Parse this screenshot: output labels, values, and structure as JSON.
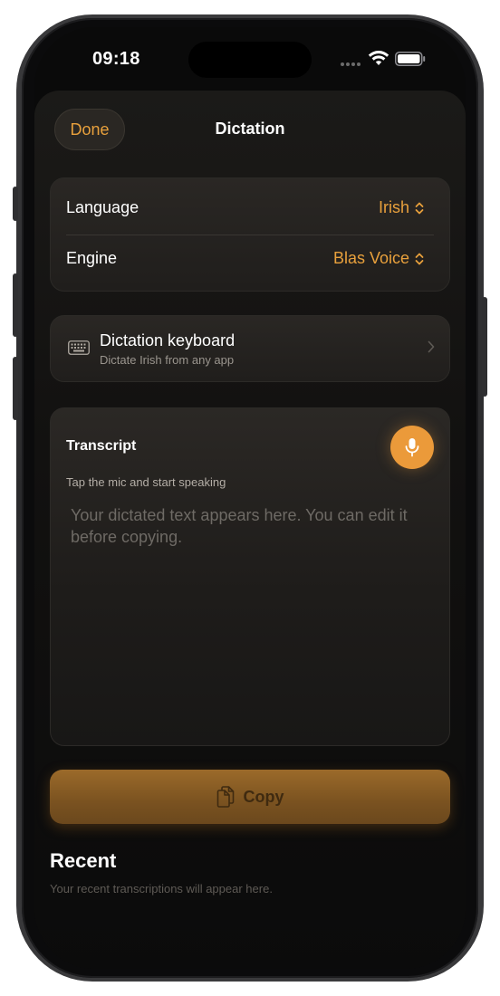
{
  "status_bar": {
    "time": "09:18",
    "icons": [
      "cellular-signal-icon",
      "wifi-icon",
      "battery-icon"
    ]
  },
  "nav": {
    "done_label": "Done",
    "title": "Dictation"
  },
  "settings": {
    "language": {
      "label": "Language",
      "value": "Irish"
    },
    "engine": {
      "label": "Engine",
      "value": "Blas Voice"
    }
  },
  "keyboard": {
    "title": "Dictation keyboard",
    "subtitle": "Dictate Irish from any app"
  },
  "transcript": {
    "title": "Transcript",
    "hint": "Tap the mic and start speaking",
    "placeholder": "Your dictated text appears here. You can edit it before copying."
  },
  "copy_button": {
    "label": "Copy"
  },
  "recent": {
    "title": "Recent",
    "empty_text": "Your recent transcriptions will appear here."
  },
  "colors": {
    "accent": "#e8a03c",
    "mic_button": "#eb9a3a",
    "background": "#0a0a0a"
  }
}
